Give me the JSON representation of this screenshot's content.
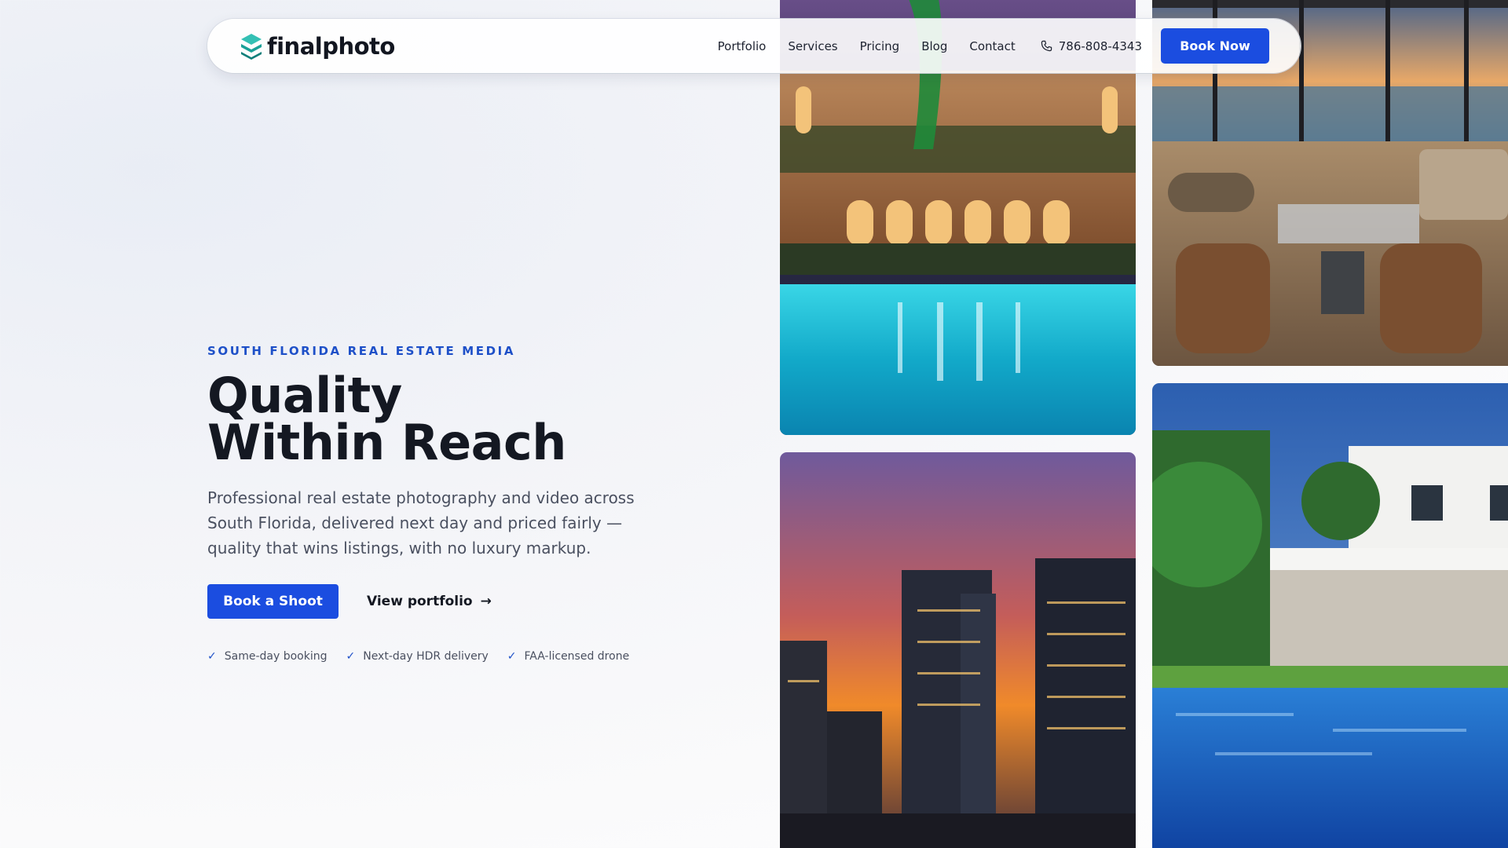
{
  "brand": {
    "name": "finalphoto",
    "accent": "#1b4de0",
    "logo_colors": [
      "#0f8f8a",
      "#34c0b4"
    ]
  },
  "nav": {
    "links": [
      "Portfolio",
      "Services",
      "Pricing",
      "Blog",
      "Contact"
    ],
    "phone": "786-808-4343",
    "phone_icon": "phone-icon",
    "book_label": "Book Now"
  },
  "hero": {
    "eyebrow": "SOUTH FLORIDA REAL ESTATE MEDIA",
    "headline_line1": "Quality",
    "headline_line2": "Within Reach",
    "lede": "Professional real estate photography and video across South Florida, delivered next day and priced fairly — quality that wins listings, with no luxury markup.",
    "cta_primary": "Book a Shoot",
    "cta_secondary": "View portfolio",
    "cta_secondary_arrow": "→",
    "features": [
      "Same-day booking",
      "Next-day HDR delivery",
      "FAA-licensed drone"
    ],
    "feature_icon": "check-icon"
  },
  "gallery": [
    {
      "subject": "night-pool-villa-photo"
    },
    {
      "subject": "waterfront-living-room-photo"
    },
    {
      "subject": "city-skyline-sunset-photo"
    },
    {
      "subject": "modern-house-pool-photo"
    }
  ]
}
